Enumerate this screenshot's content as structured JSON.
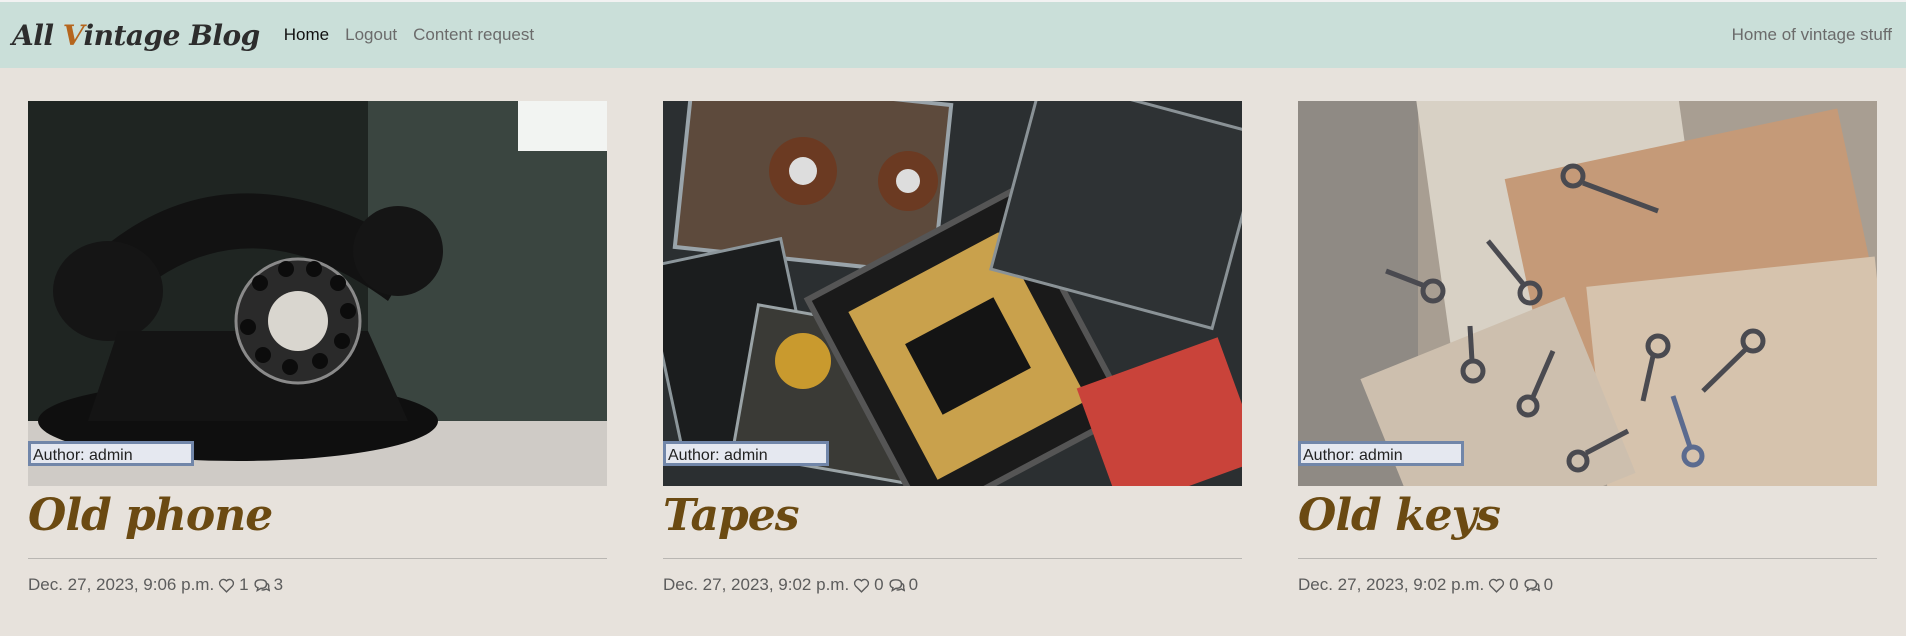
{
  "navbar": {
    "brand_prefix": "All ",
    "brand_accent": "V",
    "brand_suffix": "intage Blog",
    "links": [
      {
        "label": "Home"
      },
      {
        "label": "Logout"
      },
      {
        "label": "Content request"
      }
    ],
    "tagline": "Home of vintage stuff"
  },
  "posts": [
    {
      "title": "Old phone",
      "author": "Author: admin",
      "date": "Dec. 27, 2023, 9:06 p.m.",
      "likes": "1",
      "comments": "3"
    },
    {
      "title": "Tapes",
      "author": "Author: admin",
      "date": "Dec. 27, 2023, 9:02 p.m.",
      "likes": "0",
      "comments": "0"
    },
    {
      "title": "Old keys",
      "author": "Author: admin",
      "date": "Dec. 27, 2023, 9:02 p.m.",
      "likes": "0",
      "comments": "0"
    }
  ],
  "icons": {
    "like": "heart-icon",
    "comment": "comments-icon"
  },
  "colors": {
    "navbar": "#cadfd9",
    "page": "#e7e2dc",
    "title": "#6b4a12",
    "author_border": "#7186a9"
  }
}
